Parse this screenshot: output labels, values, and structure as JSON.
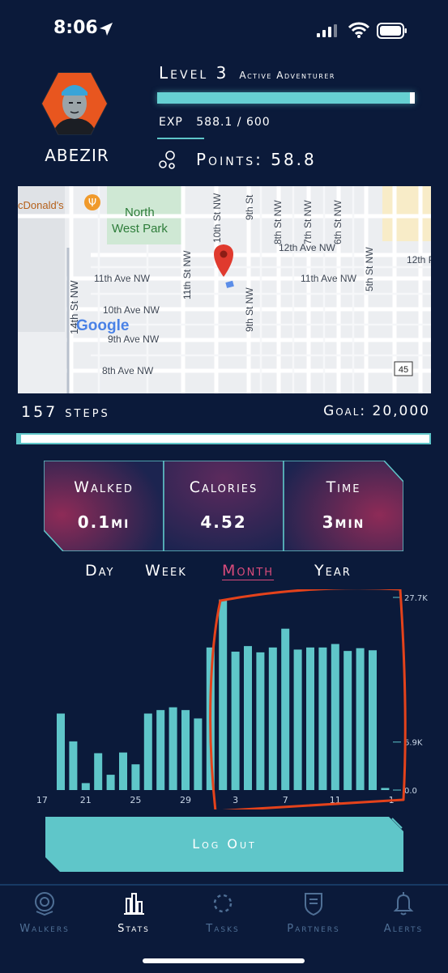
{
  "status_bar": {
    "time": "8:06"
  },
  "profile": {
    "username": "ABEZIR",
    "level_label": "Level 3",
    "level_title": "Active Adventurer",
    "exp_label": "EXP",
    "exp_value": "588.1 / 600",
    "exp_progress": 0.98,
    "points_label": "Points: 58.8"
  },
  "map": {
    "labels": {
      "mcdonalds": "cDonald's",
      "north_west_park_1": "North",
      "north_west_park_2": "West Park",
      "12th_ave": "12th Ave NW",
      "12th_p": "12th P",
      "11th_ave_left": "11th Ave NW",
      "11th_ave_right": "11th Ave NW",
      "10th_ave": "10th Ave NW",
      "9th_ave": "9th Ave NW",
      "8th_ave": "8th Ave NW",
      "14th_st": "14th St NW",
      "11th_st": "11th St NW",
      "10th_st": "10th St NW",
      "9th_st_top": "9th St",
      "9th_st": "9th St NW",
      "8th_st": "8th St NW",
      "7th_st": "7th St NW",
      "6th_st": "6th St NW",
      "5th_st": "5th St NW",
      "route": "45",
      "google": "Google"
    }
  },
  "steps": {
    "steps_label": "157 steps",
    "goal_label": "Goal: 20,000",
    "progress": 0.008
  },
  "stats": {
    "walked_label": "Walked",
    "walked_value": "0.1mi",
    "calories_label": "Calories",
    "calories_value": "4.52",
    "time_label": "Time",
    "time_value": "3min"
  },
  "tabs": {
    "day": "Day",
    "week": "Week",
    "month": "Month",
    "year": "Year",
    "selected": "Month"
  },
  "chart_data": {
    "type": "bar",
    "x_tick_labels": [
      "17",
      "21",
      "25",
      "29",
      "3",
      "7",
      "11",
      "1"
    ],
    "y_tick_labels": [
      "27.7K",
      "6.9K",
      "0.0"
    ],
    "ylim": [
      0,
      27700
    ],
    "values": [
      11000,
      7000,
      1000,
      5300,
      2200,
      5400,
      3700,
      11000,
      11500,
      11900,
      11500,
      10300,
      20500,
      27400,
      19900,
      20700,
      19800,
      20500,
      23200,
      20200,
      20500,
      20500,
      21000,
      20000,
      20400,
      20100,
      300
    ],
    "bar_color": "#5fc6c9",
    "annotation_color": "#e4421b"
  },
  "logout": {
    "label": "Log Out"
  },
  "bottom_nav": {
    "walkers": "Walkers",
    "stats": "Stats",
    "tasks": "Tasks",
    "partners": "Partners",
    "alerts": "Alerts",
    "active": "Stats"
  },
  "colors": {
    "background": "#0b1a3a",
    "accent": "#5fc6c9",
    "highlight": "#d94b7b"
  }
}
